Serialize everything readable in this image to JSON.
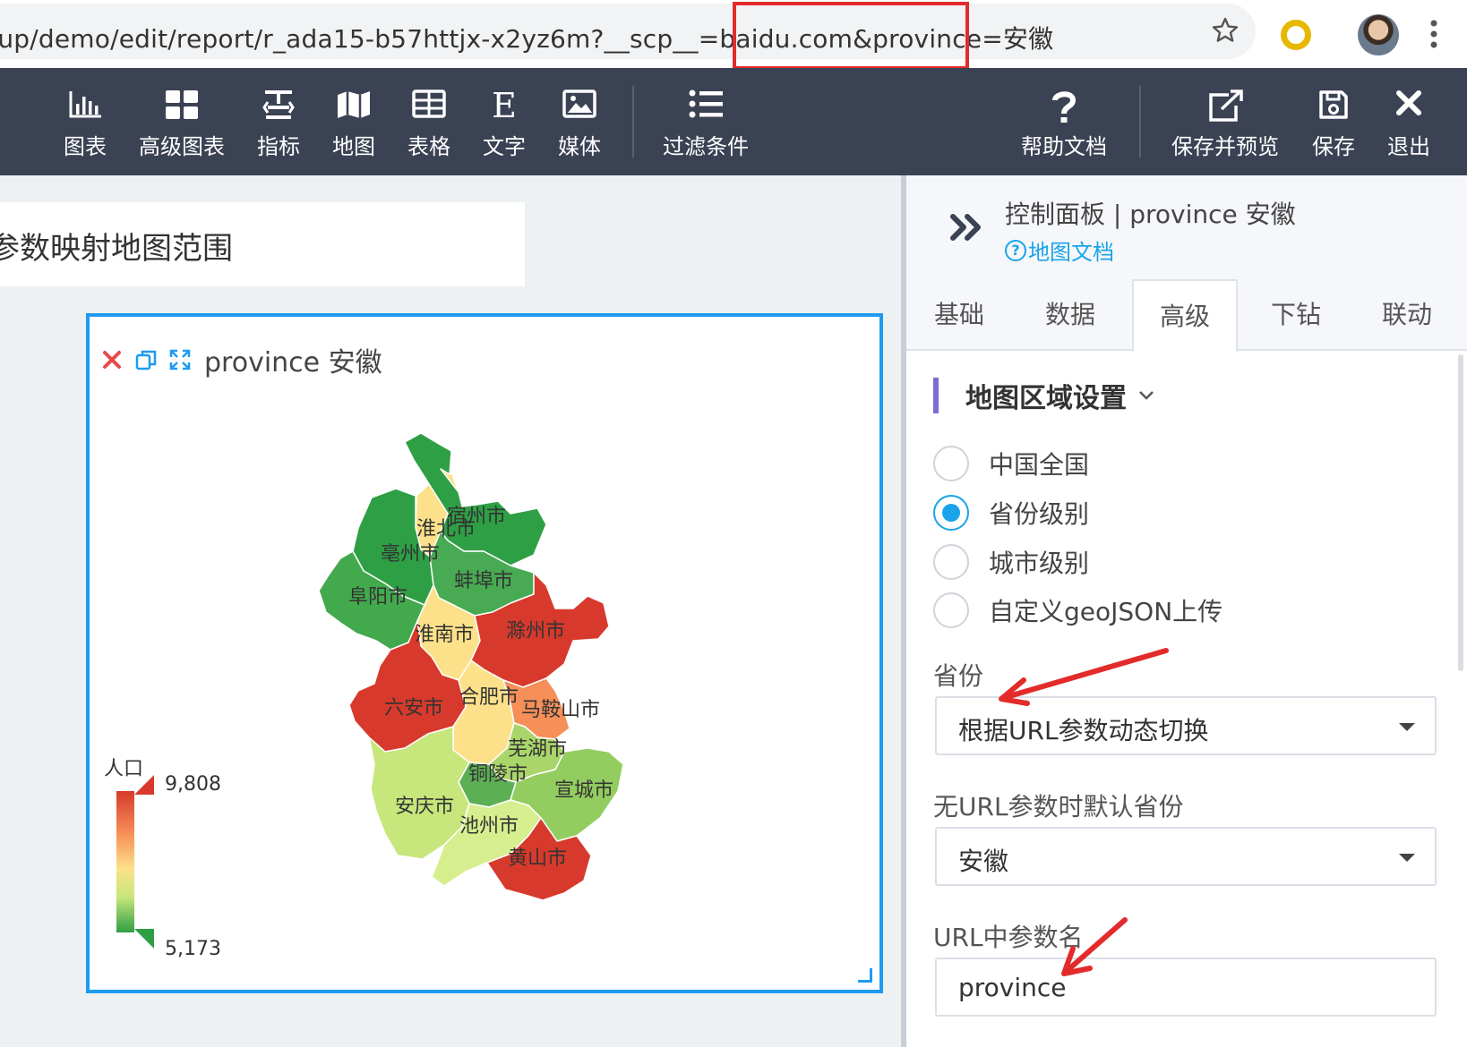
{
  "browser": {
    "url": "oup/demo/edit/report/r_ada15-b57httjx-x2yz6m?__scp__=baidu.com&province=安徽"
  },
  "toolbar": {
    "items": [
      {
        "label": "图表",
        "icon": "bar-chart-icon"
      },
      {
        "label": "高级图表",
        "icon": "grid-icon"
      },
      {
        "label": "指标",
        "icon": "indicator-icon"
      },
      {
        "label": "地图",
        "icon": "map-icon"
      },
      {
        "label": "表格",
        "icon": "table-icon"
      },
      {
        "label": "文字",
        "icon": "text-icon"
      },
      {
        "label": "媒体",
        "icon": "image-icon"
      },
      {
        "label": "过滤条件",
        "icon": "filter-list-icon"
      },
      {
        "label": "帮助文档",
        "icon": "help-icon"
      },
      {
        "label": "保存并预览",
        "icon": "edit-external-icon"
      },
      {
        "label": "保存",
        "icon": "save-icon"
      },
      {
        "label": "退出",
        "icon": "close-icon"
      }
    ]
  },
  "canvas": {
    "report_title": "参数映射地图范围",
    "widget_title": "province 安徽"
  },
  "map": {
    "legend_title": "人口",
    "legend_max": "9,808",
    "legend_min": "5,173",
    "colors": {
      "high": "#d73a2c",
      "mid": "#fde18a",
      "low": "#2e9f45"
    },
    "cities": [
      "宿州市",
      "淮北市",
      "亳州市",
      "阜阳市",
      "蚌埠市",
      "淮南市",
      "滁州市",
      "六安市",
      "合肥市",
      "马鞍山市",
      "芜湖市",
      "铜陵市",
      "宣城市",
      "安庆市",
      "池州市",
      "黄山市"
    ]
  },
  "panel": {
    "title": "控制面板 | province 安徽",
    "doc_link": "地图文档",
    "tabs": [
      "基础",
      "数据",
      "高级",
      "下钻",
      "联动"
    ],
    "active_tab": "高级",
    "section_title": "地图区域设置",
    "radio_options": [
      "中国全国",
      "省份级别",
      "城市级别",
      "自定义geoJSON上传"
    ],
    "radio_selected": "省份级别",
    "province_label": "省份",
    "province_value": "根据URL参数动态切换",
    "default_label": "无URL参数时默认省份",
    "default_value": "安徽",
    "param_label": "URL中参数名",
    "param_value": "province"
  },
  "annotation_color": "#e32b2b",
  "accent": "#1aa3e8"
}
